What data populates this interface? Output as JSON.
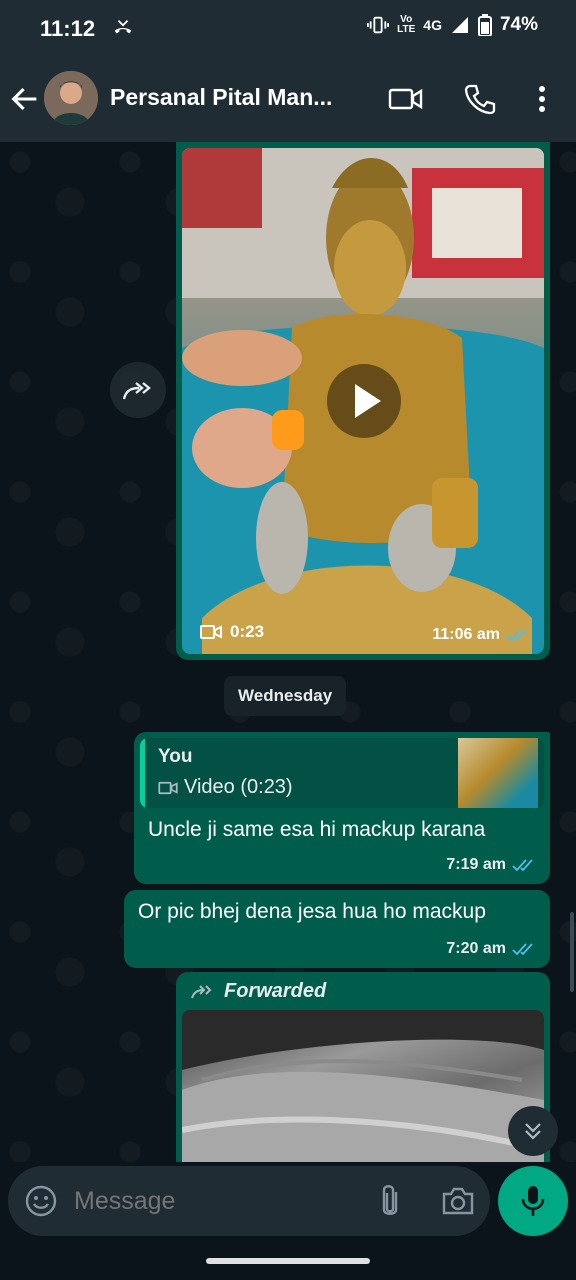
{
  "status_bar": {
    "time": "11:12",
    "network": "4G",
    "lte_label_top": "Vo",
    "lte_label_bottom": "LTE",
    "battery": "74%"
  },
  "header": {
    "title": "Persanal Pital Man..."
  },
  "messages": {
    "video": {
      "duration": "0:23",
      "time": "11:06 am"
    },
    "date_chip": "Wednesday",
    "reply": {
      "quote_author": "You",
      "quote_text": "Video (0:23)",
      "text": "Uncle ji same esa hi mackup karana",
      "time": "7:19 am"
    },
    "second": {
      "text": "Or pic bhej dena jesa hua ho mackup",
      "time": "7:20 am"
    },
    "forwarded": {
      "label": "Forwarded"
    }
  },
  "composer": {
    "placeholder": "Message"
  },
  "colors": {
    "bubble_out": "#005c4b",
    "accent": "#00a884",
    "read_ticks": "#53bdeb",
    "header_bg": "#1f2c34",
    "chat_bg": "#0b141a"
  }
}
